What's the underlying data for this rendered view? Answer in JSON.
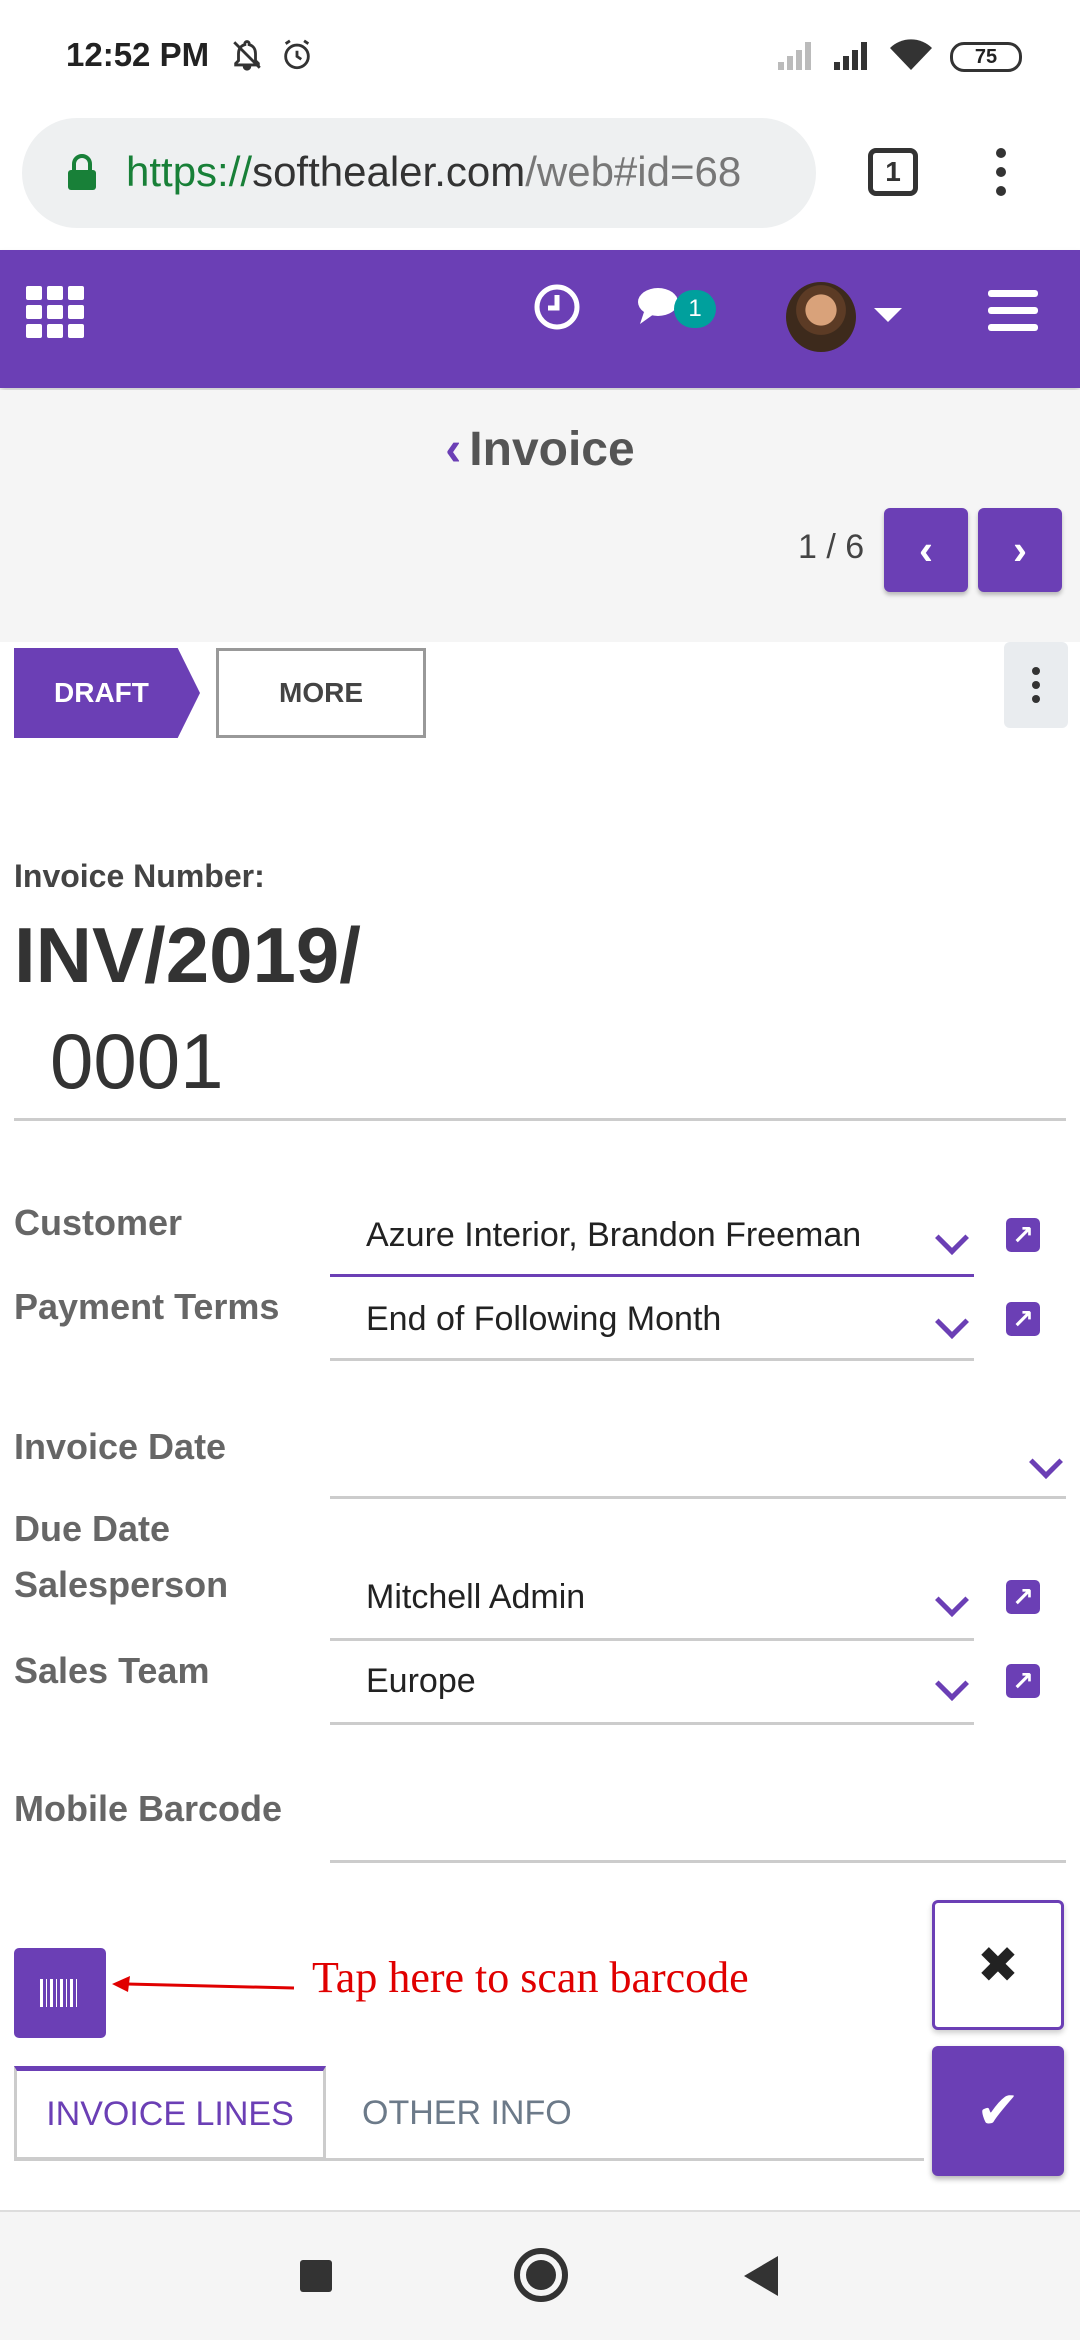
{
  "status_bar": {
    "time": "12:52 PM",
    "icons": [
      "notifications-off-icon",
      "alarm-icon",
      "signal-icon",
      "signal-icon",
      "wifi-icon"
    ],
    "battery": "75"
  },
  "browser": {
    "url_scheme": "https://",
    "url_host": "softhealer.com",
    "url_path": "/web#id=68",
    "tab_count": "1"
  },
  "topnav": {
    "chat_badge": "1",
    "colors": {
      "primary": "#6b3fb5",
      "badge": "#00a09d"
    }
  },
  "control_panel": {
    "breadcrumb_chevron": "‹",
    "breadcrumb": "Invoice",
    "pager_value": "1 / 6",
    "prev_glyph": "‹",
    "next_glyph": "›"
  },
  "statusbar_buttons": {
    "state": "DRAFT",
    "more": "MORE"
  },
  "form": {
    "number_label": "Invoice Number:",
    "number_line1": "INV/2019/",
    "number_line2": "0001",
    "fields": {
      "customer": {
        "label": "Customer",
        "value": "Azure Interior, Brandon Freeman"
      },
      "payment_terms": {
        "label": "Payment Terms",
        "value": "End of Following Month"
      },
      "invoice_date": {
        "label": "Invoice Date",
        "value": ""
      },
      "due_date": {
        "label": "Due Date"
      },
      "salesperson": {
        "label": "Salesperson",
        "value": "Mitchell Admin"
      },
      "sales_team": {
        "label": "Sales Team",
        "value": "Europe"
      },
      "mobile_barcode": {
        "label": "Mobile Barcode",
        "value": ""
      }
    }
  },
  "annotation": {
    "text": "Tap here to scan barcode",
    "color": "#e00000"
  },
  "fab": {
    "discard_glyph": "✖",
    "save_glyph": "✔"
  },
  "notebook": {
    "tabs": [
      "INVOICE LINES",
      "OTHER INFO"
    ],
    "active_tab": "INVOICE LINES"
  },
  "ext_link_glyph": "↗"
}
